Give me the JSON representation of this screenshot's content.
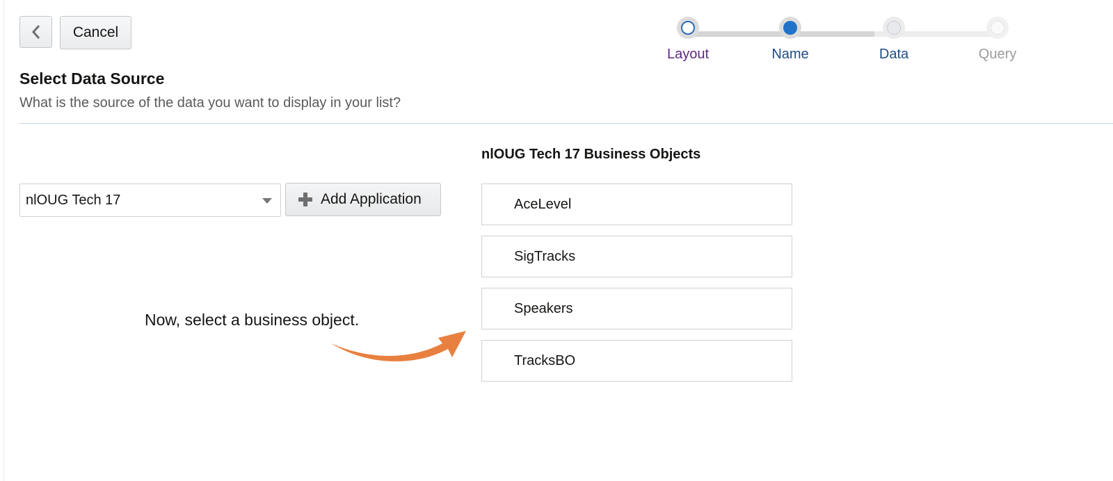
{
  "header": {
    "back_icon": "chevron-left-icon",
    "cancel_label": "Cancel"
  },
  "train": {
    "steps": [
      {
        "label": "Layout",
        "state": "visited"
      },
      {
        "label": "Name",
        "state": "current"
      },
      {
        "label": "Data",
        "state": "upcoming"
      },
      {
        "label": "Query",
        "state": "disabled"
      }
    ]
  },
  "page": {
    "title": "Select Data Source",
    "subtitle": "What is the source of the data you want to display in your list?"
  },
  "application": {
    "selected": "nlOUG Tech 17",
    "add_label": "Add Application",
    "add_icon": "plus-icon"
  },
  "business_objects": {
    "heading": "nlOUG Tech 17 Business Objects",
    "items": [
      "AceLevel",
      "SigTracks",
      "Speakers",
      "TracksBO"
    ]
  },
  "annotation": {
    "text": "Now, select a business object.",
    "arrow_color": "#e8803f"
  },
  "colors": {
    "accent": "#1f72c8",
    "visited": "#5c2781"
  }
}
